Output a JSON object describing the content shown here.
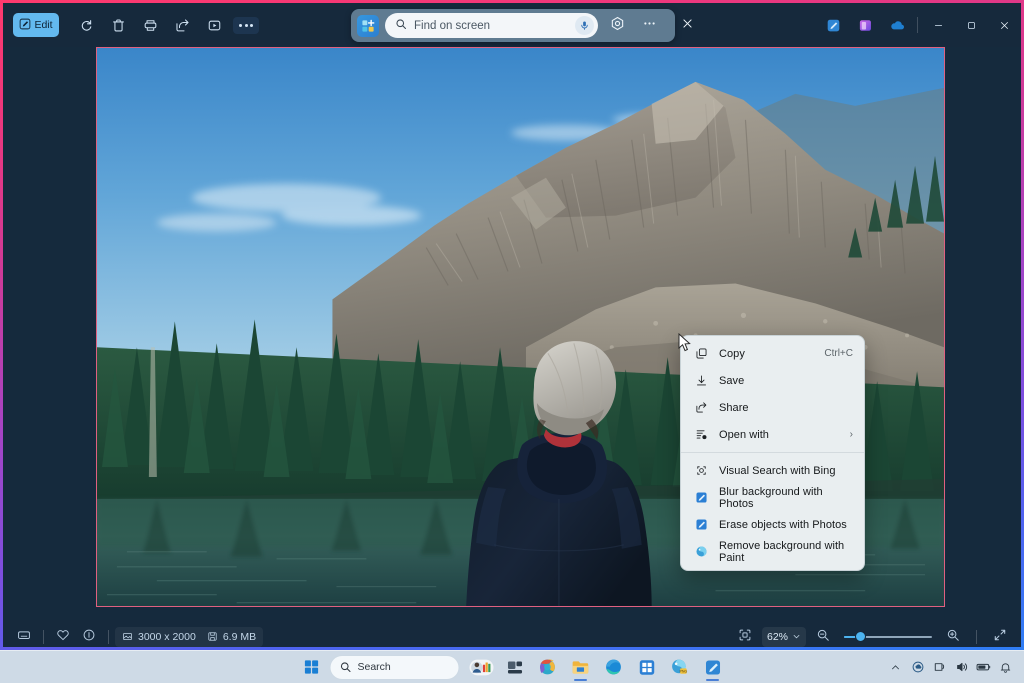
{
  "app": {
    "name": "Snipping Tool",
    "toolbar": {
      "edit_label": "Edit",
      "buttons": [
        {
          "name": "edit",
          "label": "Edit",
          "icon": "pencil-edit-icon"
        },
        {
          "name": "rotate",
          "label": "Rotate",
          "icon": "rotate-icon"
        },
        {
          "name": "delete",
          "label": "Delete",
          "icon": "trash-icon"
        },
        {
          "name": "print",
          "label": "Print",
          "icon": "printer-icon"
        },
        {
          "name": "share",
          "label": "Share",
          "icon": "share-icon"
        },
        {
          "name": "record",
          "label": "Record",
          "icon": "video-icon"
        },
        {
          "name": "more",
          "label": "See more",
          "icon": "ellipsis-icon"
        }
      ]
    },
    "find_bar": {
      "placeholder": "Find on screen",
      "value": "",
      "app_icon": "click-to-do-icon",
      "search_icon": "search-icon",
      "mic_icon": "microphone-icon",
      "visual_search_icon": "visual-search-icon",
      "more_icon": "ellipsis-icon",
      "close_icon": "close-icon"
    },
    "window_controls": {
      "minimize": "Minimize",
      "maximize": "Maximize",
      "close": "Close"
    },
    "tray_apps": [
      {
        "name": "snipping-tool",
        "label": "Snipping Tool"
      },
      {
        "name": "photos",
        "label": "Photos"
      },
      {
        "name": "onedrive",
        "label": "OneDrive"
      }
    ]
  },
  "context_menu": {
    "groups": [
      {
        "items": [
          {
            "label": "Copy",
            "accel": "Ctrl+C",
            "icon": "copy-icon",
            "submenu": false
          },
          {
            "label": "Save",
            "accel": "",
            "icon": "save-download-icon",
            "submenu": false
          },
          {
            "label": "Share",
            "accel": "",
            "icon": "share-icon",
            "submenu": false
          },
          {
            "label": "Open with",
            "accel": "",
            "icon": "open-with-icon",
            "submenu": true
          }
        ]
      },
      {
        "items": [
          {
            "label": "Visual Search with Bing",
            "accel": "",
            "icon": "visual-search-icon",
            "submenu": false
          },
          {
            "label": "Blur background with Photos",
            "accel": "",
            "icon": "photos-app-icon",
            "submenu": false
          },
          {
            "label": "Erase objects with Photos",
            "accel": "",
            "icon": "photos-app-icon",
            "submenu": false
          },
          {
            "label": "Remove background with Paint",
            "accel": "",
            "icon": "paint-app-icon",
            "submenu": false
          }
        ]
      }
    ]
  },
  "status_bar": {
    "left_buttons": [
      {
        "name": "display-mode",
        "icon": "monitor-icon"
      },
      {
        "name": "favorite",
        "icon": "heart-icon"
      },
      {
        "name": "info",
        "icon": "info-circle-icon"
      }
    ],
    "dimensions_icon": "image-size-icon",
    "dimensions": "3000 x 2000",
    "filesize_icon": "file-size-icon",
    "filesize": "6.9 MB",
    "fit_icon": "fit-to-window-icon",
    "zoom_value": "62%",
    "zoom_chevron": "chevron-down-icon",
    "zoom_out_icon": "zoom-out-icon",
    "zoom_in_icon": "zoom-in-icon",
    "fullscreen_icon": "expand-icon",
    "slider_percent": 14
  },
  "taskbar": {
    "start_label": "Start",
    "search_placeholder": "Search",
    "search_icon": "search-icon",
    "apps": [
      {
        "name": "widgets",
        "label": "Widgets",
        "active": false
      },
      {
        "name": "task-view",
        "label": "Task View",
        "active": false
      },
      {
        "name": "copilot",
        "label": "Copilot",
        "active": false
      },
      {
        "name": "file-explorer",
        "label": "File Explorer",
        "active": true
      },
      {
        "name": "edge",
        "label": "Microsoft Edge",
        "active": false
      },
      {
        "name": "microsoft-store",
        "label": "Microsoft Store",
        "active": false
      },
      {
        "name": "paint",
        "label": "Paint",
        "active": false
      },
      {
        "name": "snipping-tool",
        "label": "Snipping Tool",
        "active": true
      }
    ],
    "tray": [
      {
        "name": "show-hidden-icons",
        "icon": "chevron-up-icon"
      },
      {
        "name": "onedrive-tray",
        "icon": "onedrive-icon"
      },
      {
        "name": "network",
        "icon": "network-icon"
      },
      {
        "name": "volume",
        "icon": "speaker-icon"
      },
      {
        "name": "battery",
        "icon": "battery-icon"
      },
      {
        "name": "notifications",
        "icon": "bell-icon"
      }
    ]
  },
  "photo": {
    "alt": "Person in dark jacket and gray beanie standing at an alpine lake facing a rocky mountain ridge with evergreen forest",
    "sky_top": "#3f8fd0",
    "sky_bottom": "#9ecbe8",
    "rock": "#9a9589",
    "forest": "#1d4a38",
    "water": "#2e5a5e"
  },
  "frame": {
    "accent_start": "#ff3a6e",
    "accent_end": "#2f7ef5",
    "selection_outline": "#e06080"
  }
}
